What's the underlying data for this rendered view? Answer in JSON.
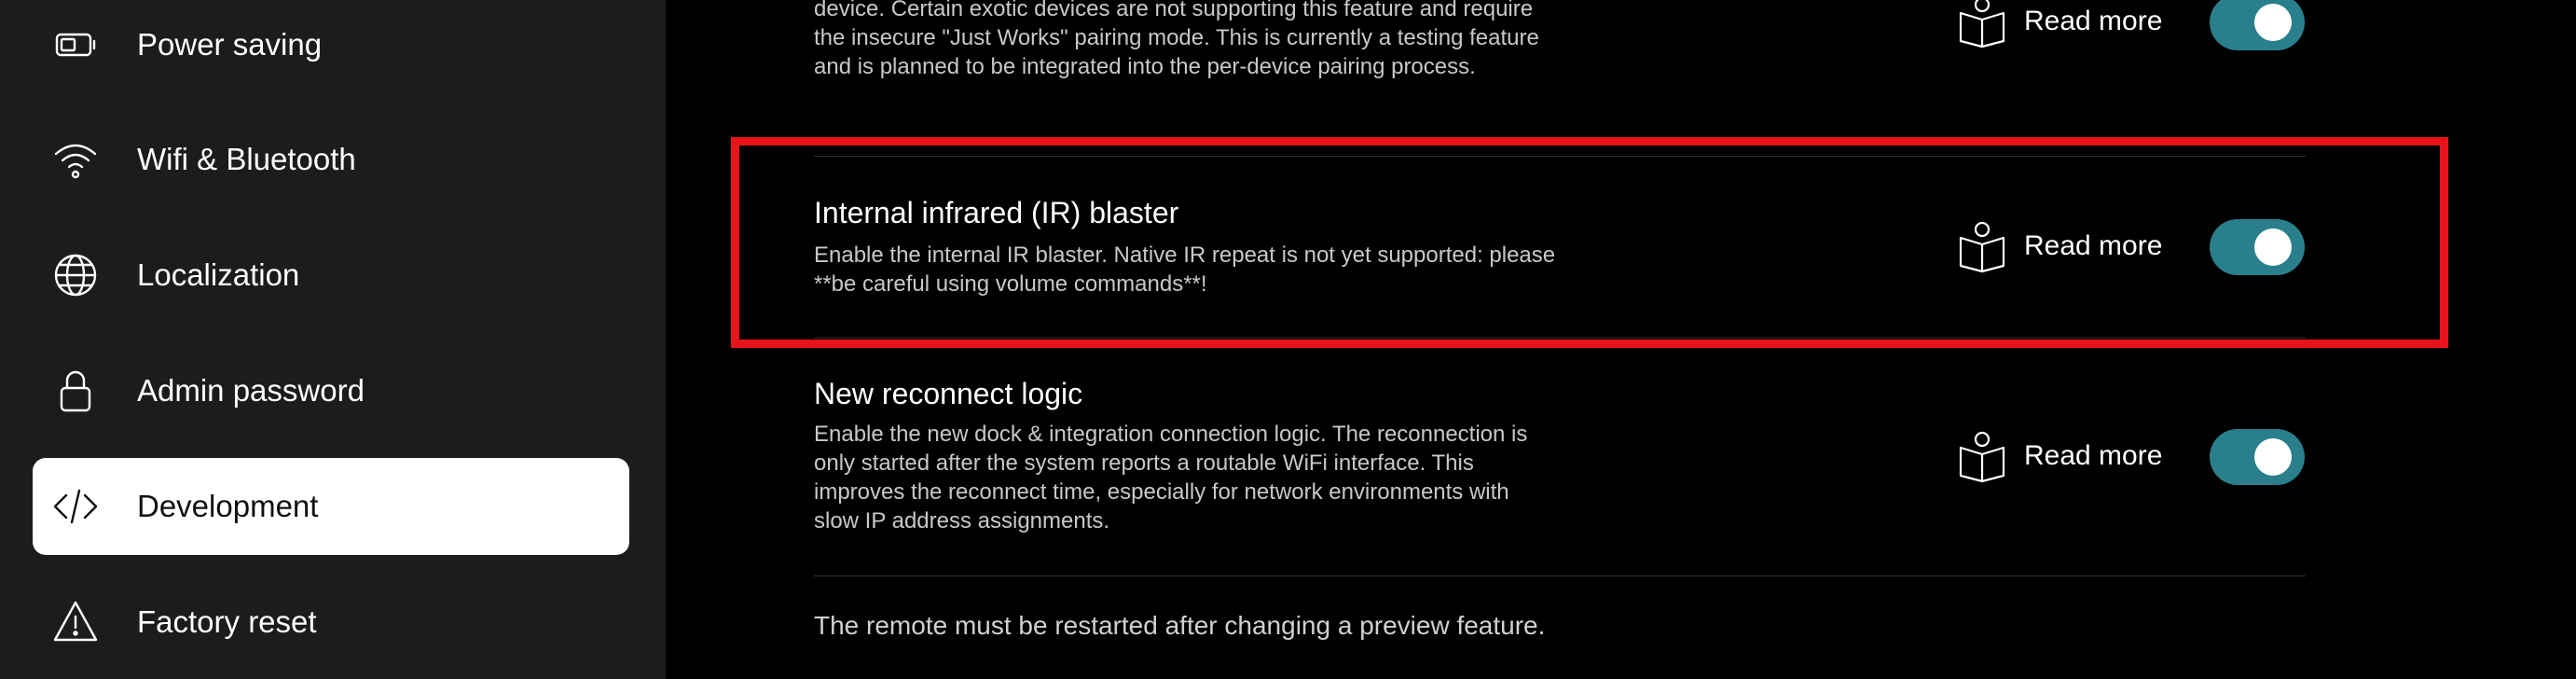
{
  "sidebar": {
    "items": [
      {
        "label": "Power saving",
        "icon": "battery-icon",
        "active": false
      },
      {
        "label": "Wifi & Bluetooth",
        "icon": "wifi-icon",
        "active": false
      },
      {
        "label": "Localization",
        "icon": "globe-icon",
        "active": false
      },
      {
        "label": "Admin password",
        "icon": "lock-icon",
        "active": false
      },
      {
        "label": "Development",
        "icon": "code-icon",
        "active": true
      },
      {
        "label": "Factory reset",
        "icon": "warning-icon",
        "active": false
      }
    ]
  },
  "settings": [
    {
      "title": "",
      "description": "device. Certain exotic devices are not supporting this feature and require the insecure \"Just Works\" pairing mode. This is currently a testing feature and is planned to be integrated into the per-device pairing process.",
      "read_more": "Read more",
      "enabled": true
    },
    {
      "title": "Internal infrared (IR) blaster",
      "description": "Enable the internal IR blaster. Native IR repeat is not yet supported: please **be careful using volume commands**!",
      "read_more": "Read more",
      "enabled": true
    },
    {
      "title": "New reconnect logic",
      "description": "Enable the new dock & integration connection logic. The reconnection is only started after the system reports a routable WiFi interface. This improves the reconnect time, especially for network environments with slow IP address assignments.",
      "read_more": "Read more",
      "enabled": true
    }
  ],
  "footer_note": "The remote must be restarted after changing a preview feature.",
  "colors": {
    "sidebar_bg": "#1c1c1c",
    "main_bg": "#000000",
    "active_item_bg": "#ffffff",
    "toggle_on": "#2a7f8c",
    "highlight": "#e8141b"
  }
}
